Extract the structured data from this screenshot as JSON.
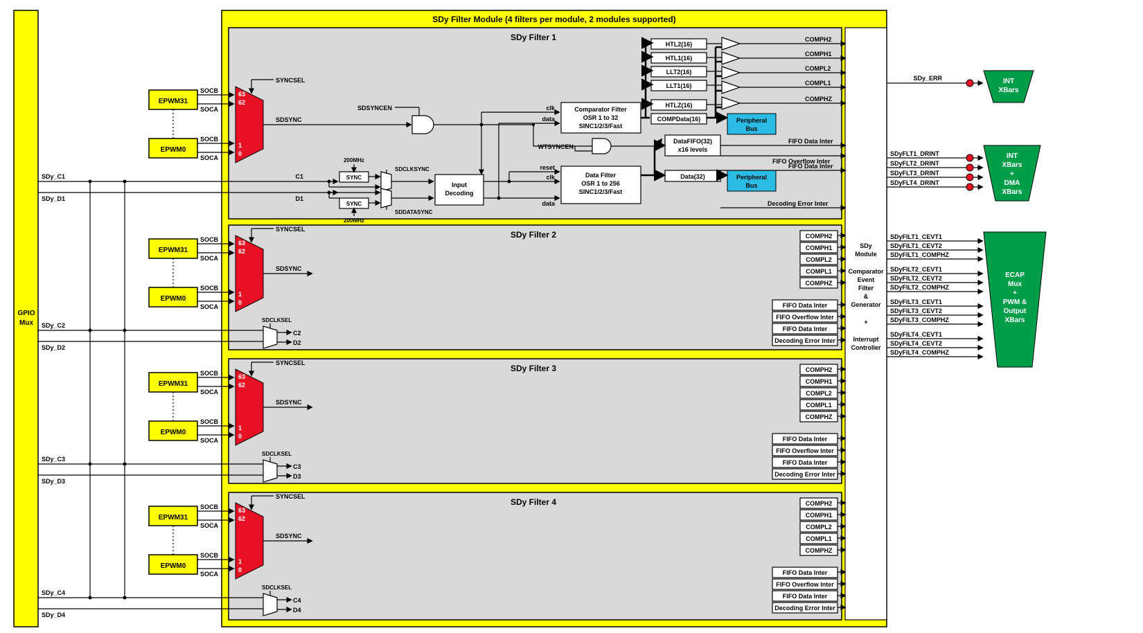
{
  "gpio_mux": "GPIO\nMux",
  "module_title": "SDy Filter  Module (4 filters per module, 2 modules supported)",
  "filter_titles": [
    "SDy Filter 1",
    "SDy Filter 2",
    "SDy Filter 3",
    "SDy Filter 4"
  ],
  "epwm_hi": "EPWM31",
  "epwm_lo": "EPWM0",
  "socb": "SOCB",
  "soca": "SOCA",
  "syncsel": "SYNCSEL",
  "sdsync": "SDSYNC",
  "sdclksel": "SDCLKSEL",
  "sdclksync": "SDCLKSYNC",
  "sddatasync": "SDDATASYNC",
  "sdsyncen": "SDSYNCEN",
  "wtsyncen": "WTSYNCEN",
  "freq": "200MHz",
  "sync": "SYNC",
  "input_decoding": "Input\nDecoding",
  "comp_filter_l1": "Comparator Filter",
  "comp_filter_l2": "OSR 1 to 32",
  "comp_filter_l3": "SINC1/2/3/Fast",
  "data_filter_l1": "Data Filter",
  "data_filter_l2": "OSR 1 to 256",
  "data_filter_l3": "SINC1/2/3/Fast",
  "clk": "clk",
  "data": "data",
  "reset": "reset",
  "htl2": "HTL2(16)",
  "htl1": "HTL1(16)",
  "llt2": "LLT2(16)",
  "llt1": "LLT1(16)",
  "htlz": "HTLZ(16)",
  "compdata": "COMPData(16)",
  "fifo": "DataFIFO(32)\nx16 levels",
  "data32": "Data(32)",
  "pbus": "Peripheral\nBus",
  "comp_outs": [
    "COMPH2",
    "COMPH1",
    "COMPL2",
    "COMPL1",
    "COMPHZ"
  ],
  "intr_outs": [
    "FIFO Data Inter",
    "FIFO Overflow Inter",
    "FIFO Data Inter",
    "Decoding Error Inter"
  ],
  "mux_labels": [
    "63",
    "62",
    "1",
    "0"
  ],
  "cd_labels": [
    "C1",
    "D1",
    "C2",
    "D2",
    "C3",
    "D3",
    "C4",
    "D4"
  ],
  "sdy_cd": [
    "SDy_C1",
    "SDy_D1",
    "SDy_C2",
    "SDy_D2",
    "SDy_C3",
    "SDy_D3",
    "SDy_C4",
    "SDy_D4"
  ],
  "event_block": "SDy\nModule\n \nComparator\nEvent\nFilter\n&\nGenerator\n \n+\n \nInterrupt\nController",
  "sdy_err": "SDy_ERR",
  "int_xbars": "INT\nXBars",
  "int_dma": "INT\nXBars\n+\nDMA\nXBars",
  "ecap": "ECAP\nMux\n+\nPWM &\nOutput\nXBars",
  "drint": [
    "SDyFLT1_DRINT",
    "SDyFLT2_DRINT",
    "SDyFLT3_DRINT",
    "SDyFLT4_DRINT"
  ],
  "cevt": [
    "SDyFILT1_CEVT1",
    "SDyFILT1_CEVT2",
    "SDyFILT1_COMPHZ",
    "SDyFILT2_CEVT1",
    "SDyFILT2_CEVT2",
    "SDyFILT2_COMPHZ",
    "SDyFILT3_CEVT1",
    "SDyFILT3_CEVT2",
    "SDyFILT3_COMPHZ",
    "SDyFILT4_CEVT1",
    "SDyFILT4_CEVT2",
    "SDyFILT4_COMPHZ"
  ]
}
